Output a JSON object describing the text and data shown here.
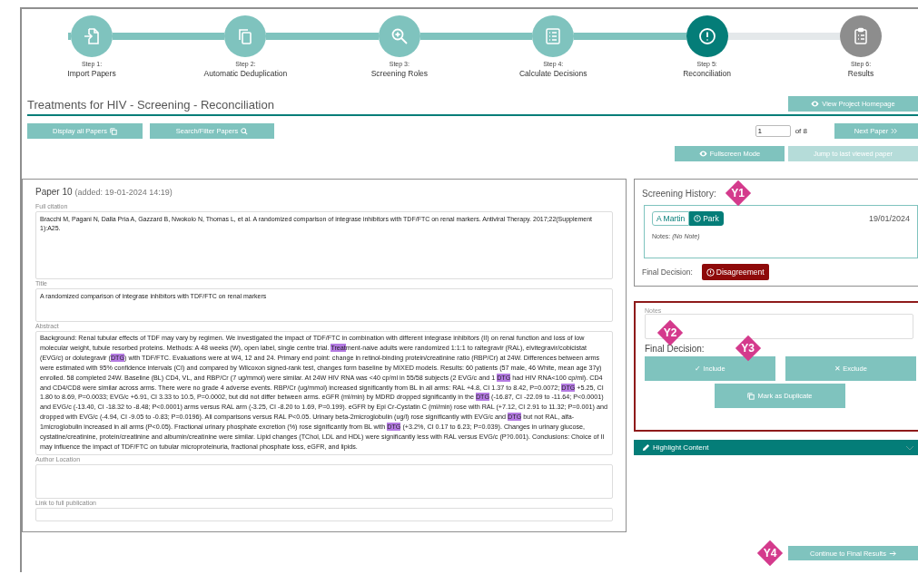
{
  "steps": [
    {
      "number": "Step 1:",
      "label": "Import Papers",
      "kind": "done"
    },
    {
      "number": "Step 2:",
      "label": "Automatic Deduplication",
      "kind": "done"
    },
    {
      "number": "Step 3:",
      "label": "Screening Roles",
      "kind": "done"
    },
    {
      "number": "Step 4:",
      "label": "Calculate Decisions",
      "kind": "done"
    },
    {
      "number": "Step 5:",
      "label": "Reconciliation",
      "kind": "current"
    },
    {
      "number": "Step 6:",
      "label": "Results",
      "kind": "pending"
    }
  ],
  "page_title": "Treatments for HIV - Screening - Reconciliation",
  "toolbar": {
    "view_home": "View Project Homepage",
    "display_all": "Display all Papers",
    "search_filter": "Search/Filter Papers",
    "page_value": "1",
    "page_total": "of 8",
    "next": "Next Paper",
    "fullscreen": "Fullscreen Mode",
    "jump": {
      "label": "Jump to last viewed paper",
      "disabled": true
    }
  },
  "paper": {
    "heading": "Paper 10",
    "added": "(added: 19-01-2024 14:19)",
    "fields": [
      {
        "label": "Full citation",
        "value": "Bracchi M, Pagani N, Dalla Pria A, Gazzard B, Nwokolo N, Thomas L, et al. A randomized comparison of integrase inhibitors with TDF/FTC on renal markers. Antiviral Therapy. 2017;22(Supplement 1):A25."
      },
      {
        "label": "Title",
        "value": "A randomized comparison of integrase inhibitors with TDF/FTC on renal markers"
      }
    ],
    "abstract_label": "Abstract",
    "abstract": [
      {
        "text": "Background: Renal tubular effects of TDF may vary by regimen. We investigated the impact of TDF/FTC in combination with different integrase inhibitors (II) on renal function and loss of low molecular weight, tubule resorbed proteins. Methods: A 48 weeks (W), open label, single centre trial. ",
        "highlighted": false
      },
      {
        "text": "Treat",
        "highlighted": true
      },
      {
        "text": "ment-naive adults were randomized 1:1:1 to raltegravir (RAL), elvitegravir/cobicistat (EVG/c) or dolutegravir (",
        "highlighted": false
      },
      {
        "text": "DTG",
        "highlighted": true
      },
      {
        "text": ") with TDF/FTC. Evaluations were at W4, 12 and 24. Primary end point: change in retinol-binding protein/creatinine ratio (RBP/Cr) at 24W. Differences between arms were estimated with 95% confidence intervals (CI) and compared by Wilcoxon signed-rank test, changes form baseline by MIXED models. Results: 60 patients (57 male, 46 White, mean age 37y) enrolled. 58 completed 24W. Baseline (BL) CD4, VL, and RBP/Cr (7 ug/mmol) were similar. At 24W HIV RNA was <40 cp/ml in 55/58 subjects (2 EVG/c and 1 ",
        "highlighted": false
      },
      {
        "text": "DTG",
        "highlighted": true
      },
      {
        "text": " had HIV RNA<100 cp/ml). CD4 and CD4/CD8 were similar across arms. There were no grade 4 adverse events. RBP/Cr (ug/mmol) increased significantly from BL in all arms: RAL +4.8, CI 1.37 to 8.42, P=0.0072; ",
        "highlighted": false
      },
      {
        "text": "DTG",
        "highlighted": true
      },
      {
        "text": " +5.25, CI 1.80 to 8.69, P=0.0033; EVG/c +6.91, CI 3.33 to 10.5, P=0.0002, but did not differ between arms. eGFR (ml/min) by MDRD dropped significantly in the ",
        "highlighted": false
      },
      {
        "text": "DTG",
        "highlighted": true
      },
      {
        "text": " (-16.87, CI -22.09 to -11.64; P<0.0001) and EVG/c (-13.40, CI -18.32 to -8.48; P<0.0001) arms versus RAL arm (-3.25, CI -8.20 to 1.69, P=0.199). eGFR by Epi Cr-Cystatin C (ml/min) rose with RAL (+7.12, CI 2.91 to 11.32; P=0.001) and dropped with EVG/c (-4.94, CI -9.05 to -0.83; P=0.0196). All comparisons versus RAL P<0.05. Urinary beta-2microglobulin (ug/l) rose significantly with EVG/c and ",
        "highlighted": false
      },
      {
        "text": "DTG",
        "highlighted": true
      },
      {
        "text": " but not RAL, alfa-1microglobulin increased in all arms (P<0.05). Fractional urinary phosphate excretion (%) rose significantly from BL with ",
        "highlighted": false
      },
      {
        "text": "DTG",
        "highlighted": true
      },
      {
        "text": " (+3.2%, CI 0.17 to 6.23; P=0.039). Changes in urinary glucose, cystatine/creatinine, protein/creatinine and albumin/creatinine were similar. Lipid changes (TChol, LDL and HDL) were significantly less with RAL versus EVG/c (P?0.001). Conclusions: Choice of II may influence the impact of TDF/FTC on tubular microproteinuria, fractional phosphate loss, eGFR, and lipids.",
        "highlighted": false
      }
    ],
    "extra_fields": [
      {
        "label": "Author Location"
      },
      {
        "label": "Link to full publication"
      }
    ]
  },
  "history": {
    "title": "Screening History:",
    "marker": "Y1",
    "entry": {
      "reviewers": [
        {
          "name": "A Martin",
          "flagged": false
        },
        {
          "name": "Park",
          "flagged": true
        }
      ],
      "date": "19/01/2024",
      "notes_label": "Notes:",
      "notes": "(No Note)"
    },
    "final_label": "Final Decision:",
    "final_value": "Disagreement"
  },
  "decision": {
    "notes_label": "Notes",
    "notes_marker": "Y2",
    "final_label": "Final Decision:",
    "final_marker": "Y3",
    "include": "✓ Include",
    "exclude": "✕ Exclude",
    "duplicate": "Mark as Duplicate"
  },
  "highlight": {
    "label": "Highlight Content",
    "expanded": false
  },
  "continue": {
    "label": "Continue to Final Results",
    "marker": "Y4"
  }
}
